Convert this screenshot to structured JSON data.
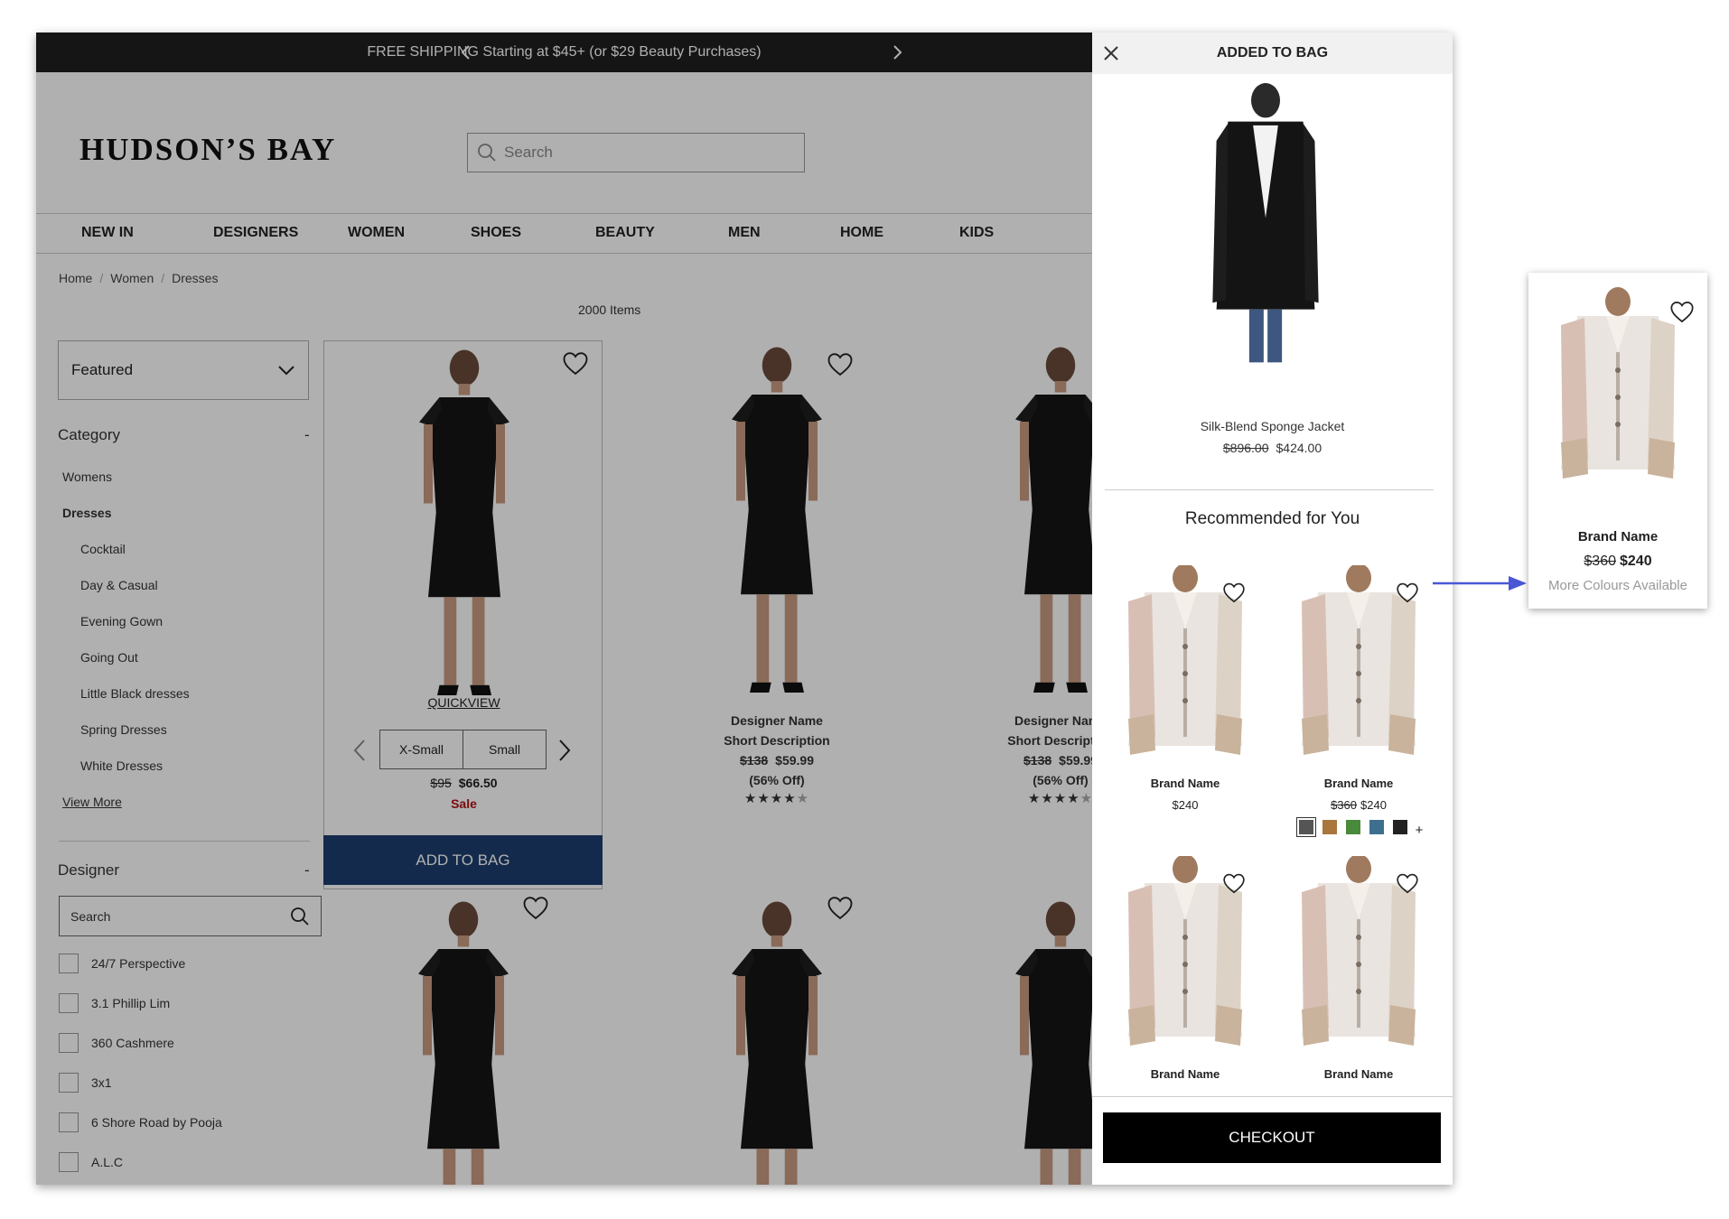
{
  "promo": {
    "text": "FREE SHIPPING Starting at $45+ (or $29 Beauty Purchases)"
  },
  "header": {
    "logo": "HUDSON’S BAY",
    "search_placeholder": "Search"
  },
  "nav": [
    "NEW IN",
    "DESIGNERS",
    "WOMEN",
    "SHOES",
    "BEAUTY",
    "MEN",
    "HOME",
    "KIDS"
  ],
  "breadcrumb": [
    "Home",
    "Women",
    "Dresses"
  ],
  "item_count": "2000 Items",
  "sort": {
    "label": "Featured"
  },
  "filters": {
    "category_title": "Category",
    "collapse": "-",
    "categories": [
      "Womens",
      "Dresses",
      "Cocktail",
      "Day & Casual",
      "Evening Gown",
      "Going Out",
      "Little Black dresses",
      "Spring Dresses",
      "White Dresses"
    ],
    "view_more": "View More",
    "designer_title": "Designer",
    "designer_search": "Search",
    "designers": [
      "24/7 Perspective",
      "3.1 Phillip Lim",
      "360 Cashmere",
      "3x1",
      "6 Shore Road by Pooja",
      "A.L.C"
    ]
  },
  "quickview": {
    "label": "QUICKVIEW",
    "sizes": [
      "X-Small",
      "Small"
    ],
    "old_price": "$95",
    "price": "$66.50",
    "sale": "Sale",
    "add_to_bag": "ADD TO BAG"
  },
  "products": {
    "name": "Designer Name",
    "desc": "Short Description",
    "old_price": "$138",
    "price": "$59.99",
    "discount": "(56% Off)",
    "rating": 4
  },
  "bag_panel": {
    "title": "ADDED TO BAG",
    "item_name": "Silk-Blend Sponge Jacket",
    "item_old_price": "$896.00",
    "item_price": "$424.00",
    "rec_title": "Recommended for You",
    "recs": [
      {
        "name": "Brand Name",
        "price": "$240"
      },
      {
        "name": "Brand Name",
        "old_price": "$360",
        "price": "$240"
      },
      {
        "name": "Brand Name"
      },
      {
        "name": "Brand Name"
      }
    ],
    "swatch_colors": [
      "#555555",
      "#a9763e",
      "#4a8a3c",
      "#3f6f8f",
      "#222222"
    ],
    "more": "+",
    "checkout": "CHECKOUT"
  },
  "zoom_card": {
    "name": "Brand Name",
    "old_price": "$360",
    "price": "$240",
    "note": "More Colours Available"
  },
  "colors": {
    "accent_blue": "#1c3e6e",
    "sale_red": "#b31217",
    "arrow": "#4a56d6"
  }
}
